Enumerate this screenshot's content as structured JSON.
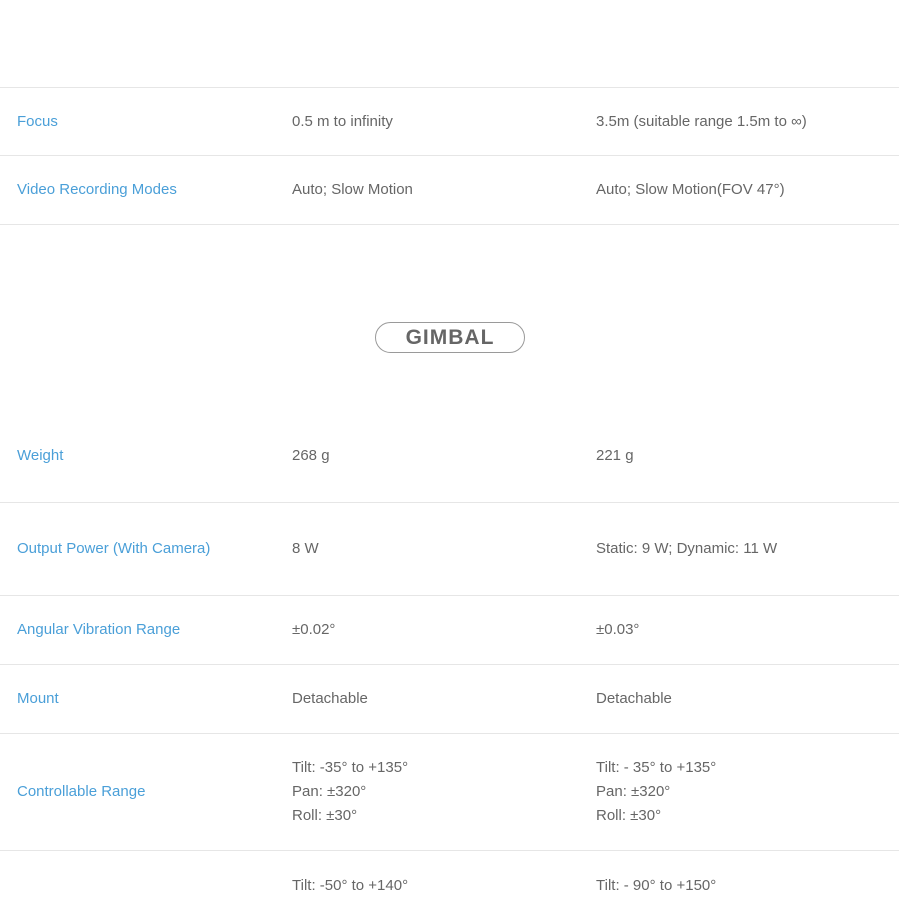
{
  "camera_rows": [
    {
      "label": "Focus",
      "a": [
        "0.5 m to infinity"
      ],
      "b": [
        "3.5m (suitable range 1.5m to ∞)"
      ]
    },
    {
      "label": "Video Recording Modes",
      "a": [
        "Auto; Slow Motion"
      ],
      "b": [
        "Auto; Slow Motion(FOV 47°)"
      ]
    }
  ],
  "section": {
    "title": "GIMBAL"
  },
  "gimbal_rows": [
    {
      "label": "Weight",
      "a": [
        "268 g"
      ],
      "b": [
        "221 g"
      ]
    },
    {
      "label": "Output Power (With Camera)",
      "a": [
        "8 W"
      ],
      "b": [
        "Static: 9 W; Dynamic: 11 W"
      ]
    },
    {
      "label": "Angular Vibration Range",
      "a": [
        "±0.02°"
      ],
      "b": [
        "±0.03°"
      ]
    },
    {
      "label": "Mount",
      "a": [
        "Detachable"
      ],
      "b": [
        "Detachable"
      ]
    },
    {
      "label": "Controllable Range",
      "a": [
        "Tilt: -35° to +135°",
        "Pan: ±320°",
        "Roll: ±30°"
      ],
      "b": [
        "Tilt: - 35° to +135°",
        "Pan: ±320°",
        "Roll: ±30°"
      ]
    },
    {
      "label": "",
      "a": [
        "Tilt: -50° to +140°"
      ],
      "b": [
        "Tilt: - 90° to +150°"
      ]
    }
  ],
  "colors": {
    "label": "#4a9fd8",
    "value": "#666666",
    "divider": "#e6e6e6"
  }
}
